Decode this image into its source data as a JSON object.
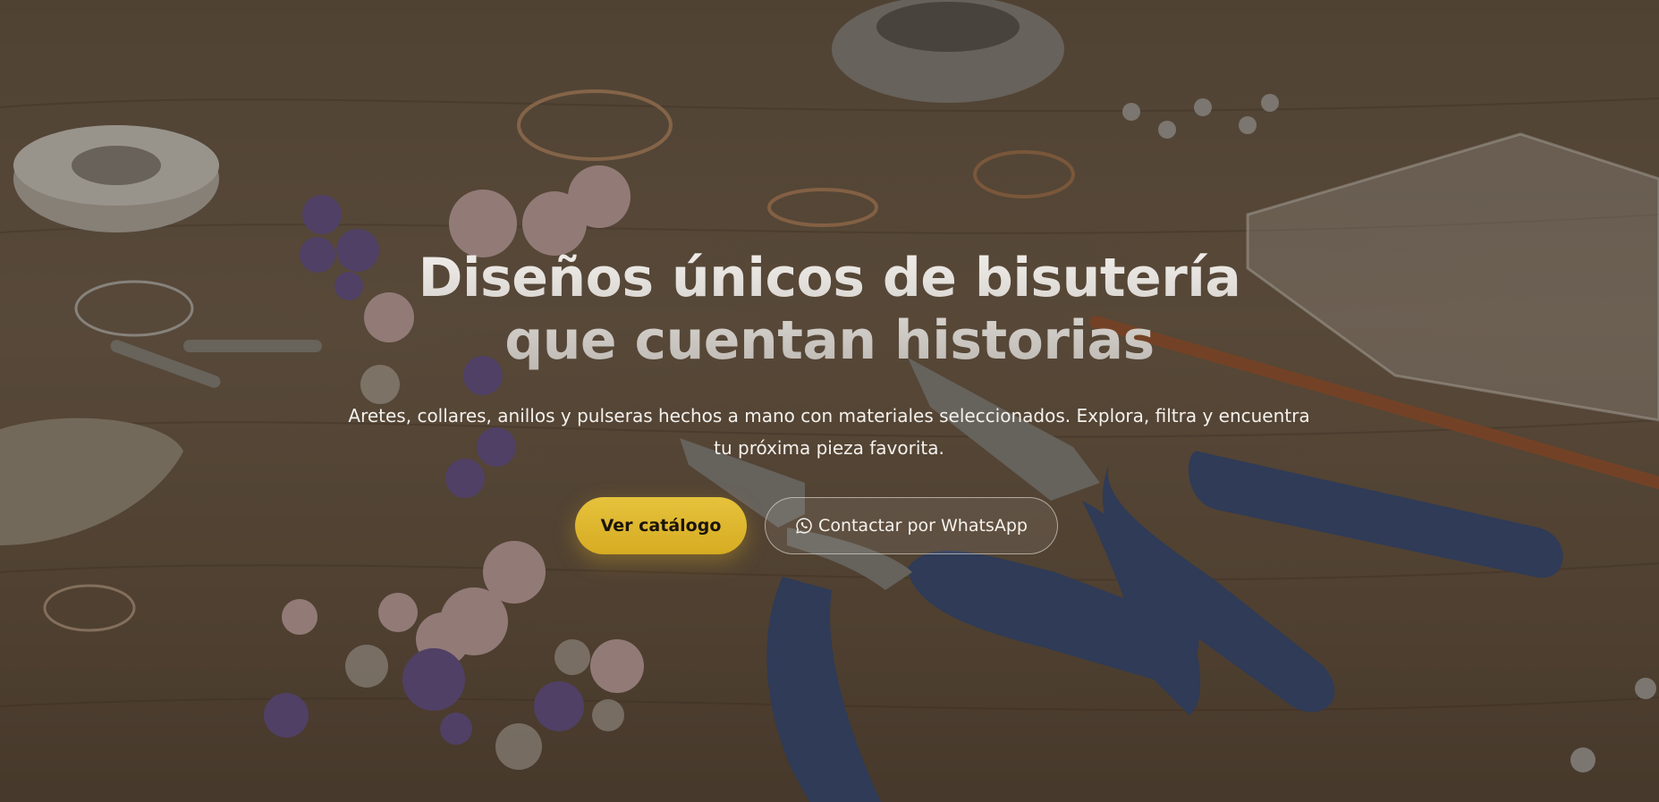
{
  "hero": {
    "title_line1": "Diseños únicos de bisutería",
    "title_line2": "que cuentan historias",
    "subtitle": "Aretes, collares, anillos y pulseras hechos a mano con materiales seleccionados. Explora, filtra y encuentra tu próxima pieza favorita.",
    "primary_button": "Ver catálogo",
    "secondary_button": "Contactar por WhatsApp",
    "secondary_icon": "whatsapp-icon",
    "background_description_colors": {
      "wood": "#7a6652",
      "accent_gold": "#e0b830",
      "pliers_blue": "#3b4f7a",
      "bead_purple": "#6b568f",
      "bead_pink": "#c9aaa8"
    }
  }
}
